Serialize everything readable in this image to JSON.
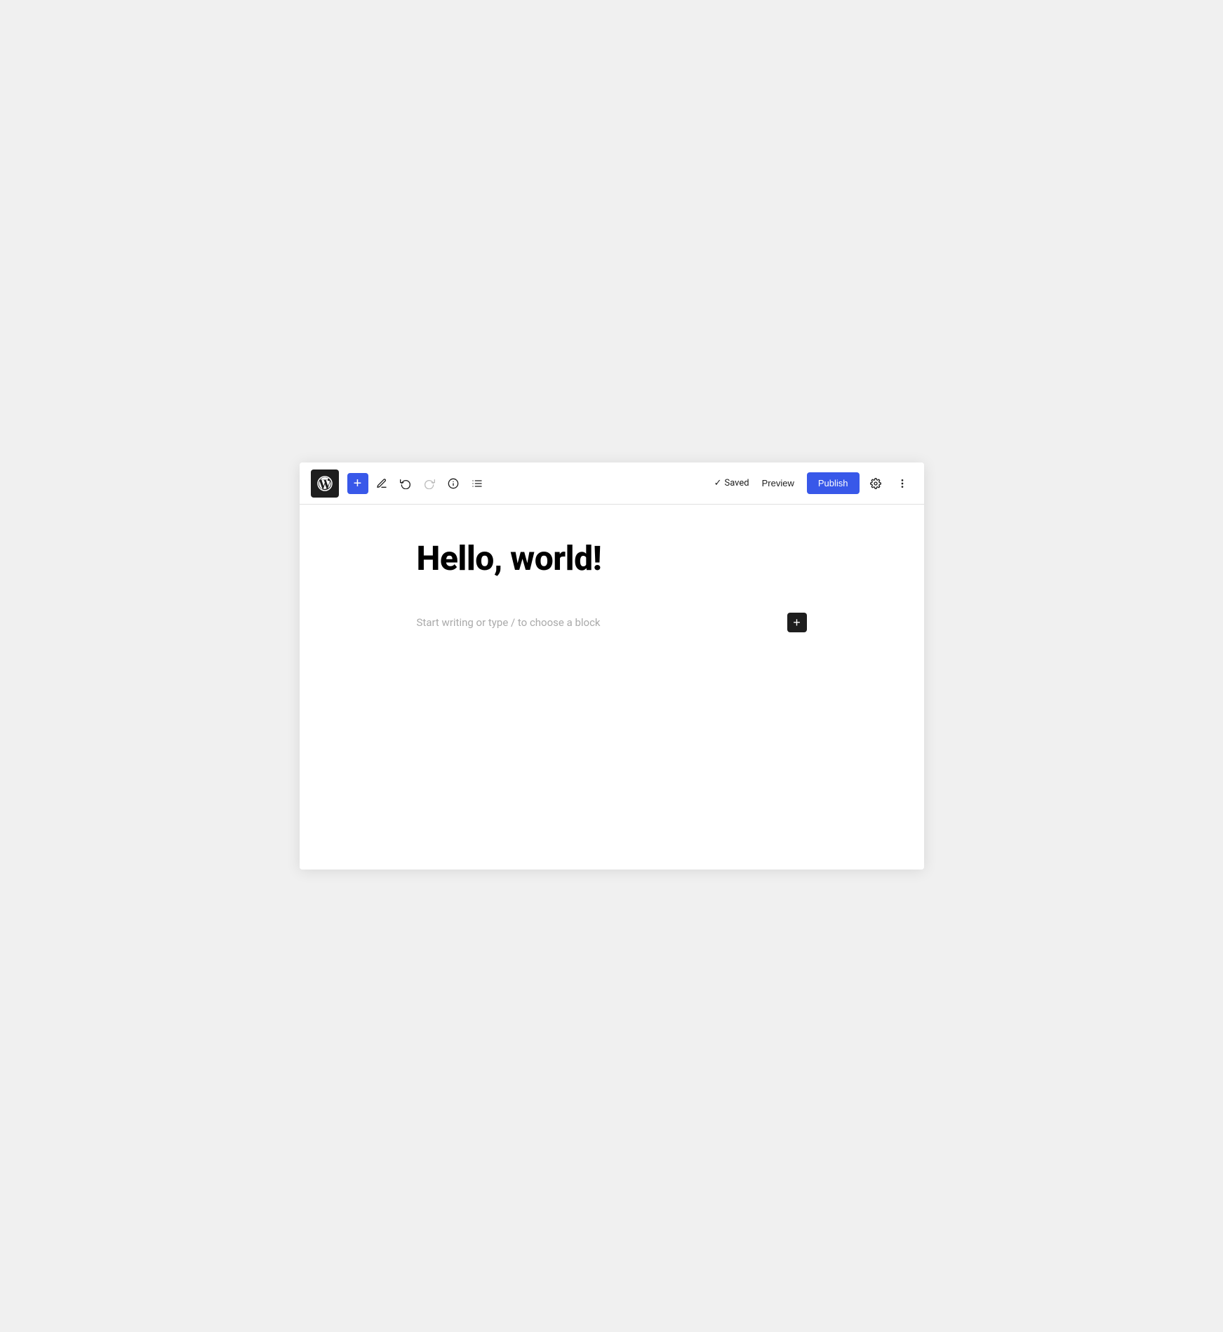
{
  "toolbar": {
    "wp_logo_label": "WordPress",
    "add_block_label": "+",
    "tools": [
      {
        "name": "pencil",
        "symbol": "✏",
        "label": "Tools"
      },
      {
        "name": "undo",
        "symbol": "↺",
        "label": "Undo"
      },
      {
        "name": "redo",
        "symbol": "↻",
        "label": "Redo"
      },
      {
        "name": "info",
        "symbol": "ℹ",
        "label": "Details"
      },
      {
        "name": "list",
        "symbol": "≡",
        "label": "List View"
      }
    ],
    "saved_label": "Saved",
    "preview_label": "Preview",
    "publish_label": "Publish",
    "settings_label": "Settings",
    "more_label": "⋮"
  },
  "editor": {
    "post_title": "Hello, world!",
    "block_placeholder": "Start writing or type / to choose a block",
    "add_block_inline_label": "+"
  },
  "colors": {
    "accent": "#3858e9",
    "dark": "#1e1e1e",
    "bg_page": "#f0f0f0",
    "bg_editor": "#ffffff"
  }
}
